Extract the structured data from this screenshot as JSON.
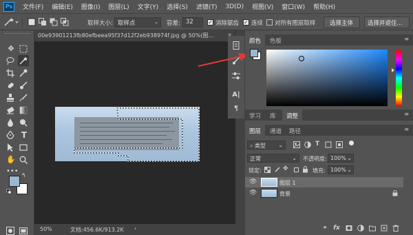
{
  "app": {
    "logo": "Ps"
  },
  "menu": [
    "文件(F)",
    "编辑(E)",
    "图像(I)",
    "图层(L)",
    "文字(Y)",
    "选择(S)",
    "滤镜(T)",
    "3D(D)",
    "视图(V)",
    "窗口(W)",
    "帮助(H)"
  ],
  "options": {
    "sample_size_label": "取样大小:",
    "sample_size_value": "取样点",
    "tolerance_label": "容差:",
    "tolerance_value": "32",
    "antialias_label": "消除锯齿",
    "contiguous_label": "连续",
    "sample_all_label": "对所有图层取样",
    "select_subject_button": "选择主体",
    "select_and_mask_button": "选择并遮住..."
  },
  "document": {
    "tab_title": "00e93901213fb80efbeea95f37d12f2eb938974f.jpg @ 50%(图...",
    "close": "×",
    "zoom": "50%",
    "doc_info": "文档:456.6K/913.2K",
    "status_arrow": "›"
  },
  "color_panel": {
    "tabs": [
      "颜色",
      "色板"
    ],
    "foreground": "#9bb8d3",
    "background": "#ffffff"
  },
  "adjust_panel": {
    "tabs": [
      "学习",
      "库",
      "调整"
    ]
  },
  "layers_panel": {
    "tabs": [
      "图层",
      "通道",
      "路径"
    ],
    "filter_label": "类型",
    "blend_mode": "正常",
    "opacity_label": "不透明度:",
    "opacity_value": "100%",
    "lock_label": "锁定:",
    "fill_label": "填充:",
    "fill_value": "100%",
    "layers": [
      {
        "name": "图层 1",
        "selected": true
      },
      {
        "name": "背景",
        "selected": false
      }
    ]
  },
  "colors": {
    "accent": "#31a8ff",
    "arrow": "#e03a3a",
    "selection": "#ffffff"
  }
}
